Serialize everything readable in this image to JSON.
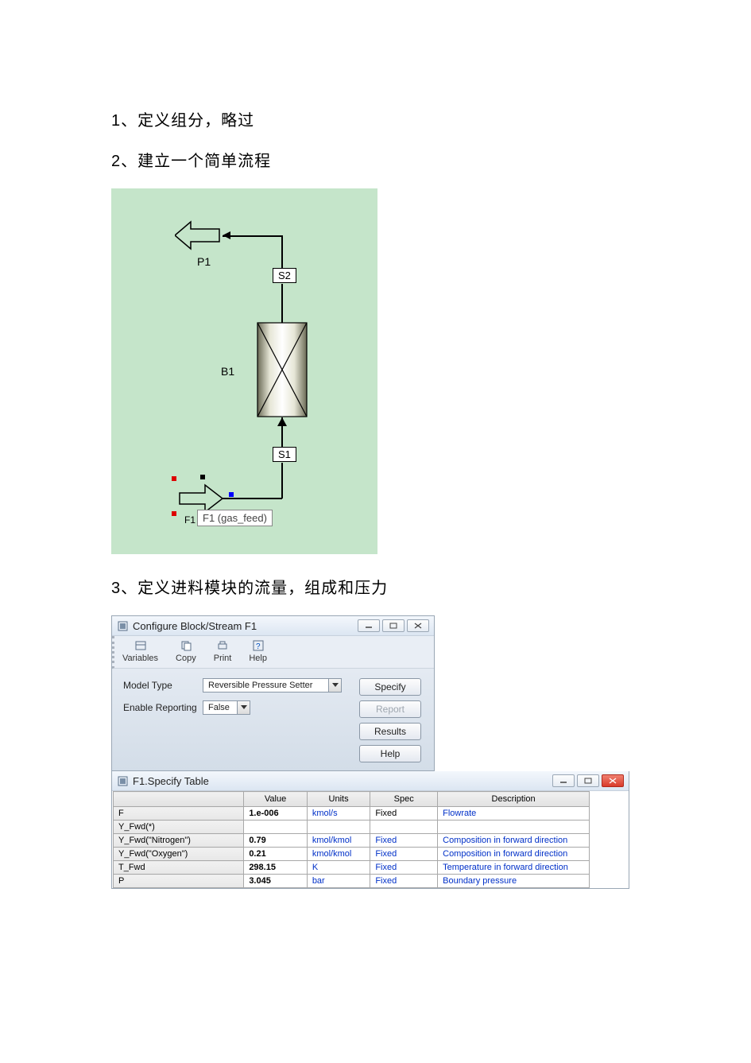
{
  "steps": {
    "s1": "1、定义组分，略过",
    "s2": "2、建立一个简单流程",
    "s3": "3、定义进料模块的流量，组成和压力"
  },
  "flowchart": {
    "labels": {
      "P1": "P1",
      "B1": "B1",
      "S1": "S1",
      "S2": "S2",
      "F1": "F1"
    },
    "feed_label": "F1 (gas_feed)"
  },
  "configure_window": {
    "title": "Configure Block/Stream F1",
    "toolbar": {
      "variables": "Variables",
      "copy": "Copy",
      "print": "Print",
      "help": "Help"
    },
    "fields": {
      "model_type_label": "Model Type",
      "model_type_value": "Reversible Pressure Setter",
      "enable_reporting_label": "Enable Reporting",
      "enable_reporting_value": "False"
    },
    "buttons": {
      "specify": "Specify",
      "report": "Report",
      "results": "Results",
      "help": "Help"
    }
  },
  "specify_window": {
    "title": "F1.Specify Table",
    "headers": {
      "name": "",
      "value": "Value",
      "units": "Units",
      "spec": "Spec",
      "description": "Description"
    },
    "rows": [
      {
        "name": "F",
        "value": "1.e-006",
        "units": "kmol/s",
        "spec": "Fixed",
        "description": "Flowrate"
      },
      {
        "name": "Y_Fwd(*)",
        "value": "",
        "units": "",
        "spec": "",
        "description": ""
      },
      {
        "name": "Y_Fwd(\"Nitrogen\")",
        "value": "0.79",
        "units": "kmol/kmol",
        "spec": "Fixed",
        "description": "Composition in forward direction"
      },
      {
        "name": "Y_Fwd(\"Oxygen\")",
        "value": "0.21",
        "units": "kmol/kmol",
        "spec": "Fixed",
        "description": "Composition in forward direction"
      },
      {
        "name": "T_Fwd",
        "value": "298.15",
        "units": "K",
        "spec": "Fixed",
        "description": "Temperature in forward direction"
      },
      {
        "name": "P",
        "value": "3.045",
        "units": "bar",
        "spec": "Fixed",
        "description": "Boundary pressure"
      }
    ]
  }
}
